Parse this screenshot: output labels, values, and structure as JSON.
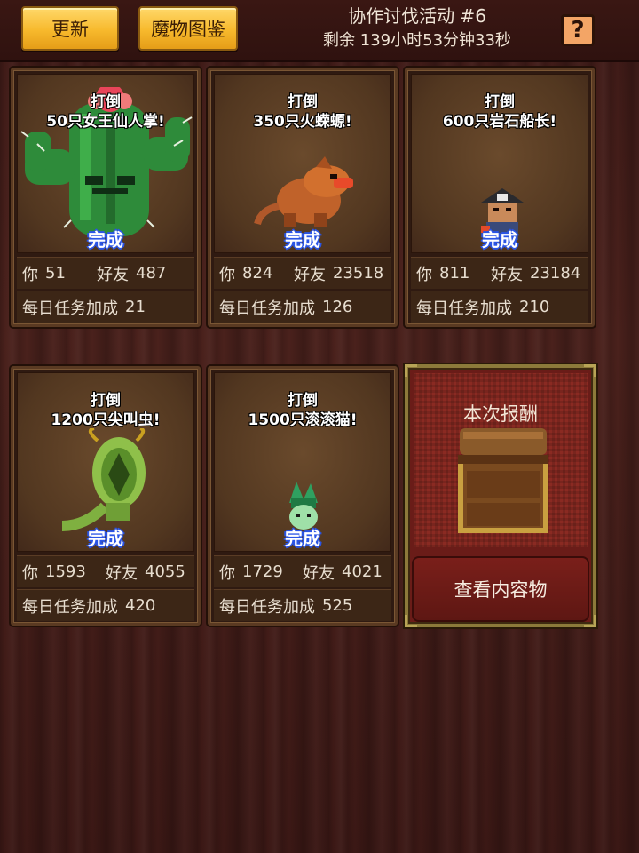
{
  "header": {
    "update_label": "更新",
    "bestiary_label": "魔物图鉴",
    "event_title": "协作讨伐活动 #6",
    "timer_text": "剩余 139小时53分钟33秒",
    "help_glyph": "?"
  },
  "labels": {
    "you": "你",
    "friends": "好友",
    "daily_bonus": "每日任务加成",
    "done": "完成"
  },
  "quests": [
    {
      "line1": "打倒",
      "line2": "50只女王仙人掌!",
      "you": "51",
      "friends": "487",
      "bonus": "21",
      "monster": "queen-cactus"
    },
    {
      "line1": "打倒",
      "line2": "350只火蝾螈!",
      "you": "824",
      "friends": "23518",
      "bonus": "126",
      "monster": "fire-salamander"
    },
    {
      "line1": "打倒",
      "line2": "600只岩石船长!",
      "you": "811",
      "friends": "23184",
      "bonus": "210",
      "monster": "rock-captain"
    },
    {
      "line1": "打倒",
      "line2": "1200只尖叫虫!",
      "you": "1593",
      "friends": "4055",
      "bonus": "420",
      "monster": "screaming-bug"
    },
    {
      "line1": "打倒",
      "line2": "1500只滚滚猫!",
      "you": "1729",
      "friends": "4021",
      "bonus": "525",
      "monster": "rolling-cat"
    }
  ],
  "reward": {
    "title": "本次报酬",
    "view_label": "查看内容物"
  },
  "colors": {
    "accent_gold": "#f7b92c",
    "done_blue": "#2a55e6",
    "reward_red": "#8a2a22"
  }
}
